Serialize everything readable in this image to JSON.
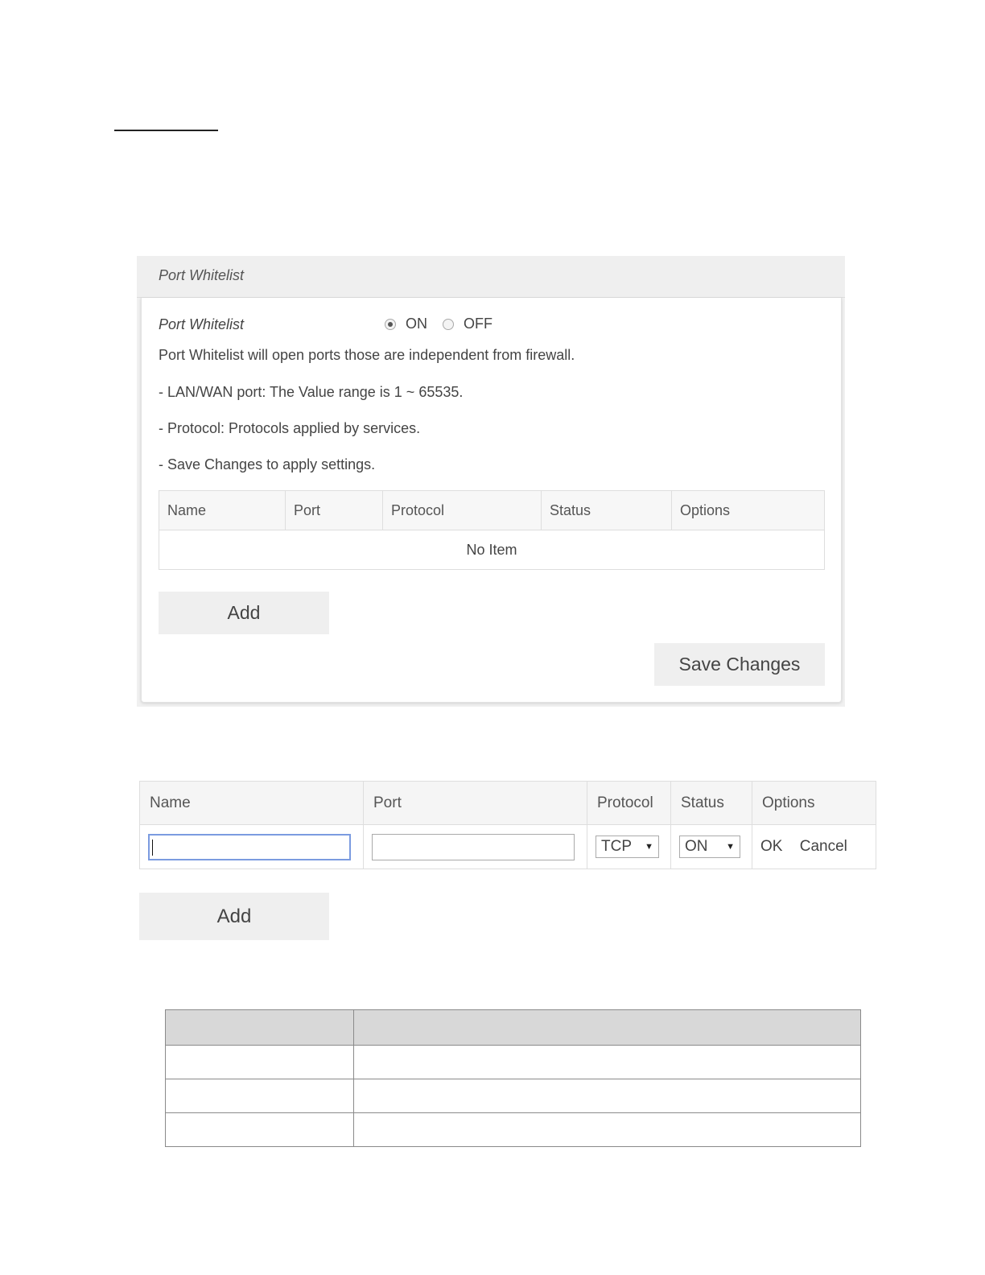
{
  "panel": {
    "title": "Port Whitelist",
    "setting_label": "Port Whitelist",
    "radio_on_label": "ON",
    "radio_off_label": "OFF",
    "selected": "ON",
    "description": "Port Whitelist will open ports those are independent from firewall.",
    "notes": [
      "- LAN/WAN port: The Value range is 1 ~ 65535.",
      "- Protocol: Protocols applied by services.",
      "- Save Changes to apply settings."
    ],
    "table": {
      "headers": [
        "Name",
        "Port",
        "Protocol",
        "Status",
        "Options"
      ],
      "empty_text": "No Item"
    },
    "add_label": "Add",
    "save_label": "Save Changes"
  },
  "edit_table": {
    "headers": [
      "Name",
      "Port",
      "Protocol",
      "Status",
      "Options"
    ],
    "row": {
      "name_value": "",
      "port_value": "",
      "protocol_value": "TCP",
      "status_value": "ON",
      "ok_label": "OK",
      "cancel_label": "Cancel"
    },
    "add_label": "Add"
  }
}
